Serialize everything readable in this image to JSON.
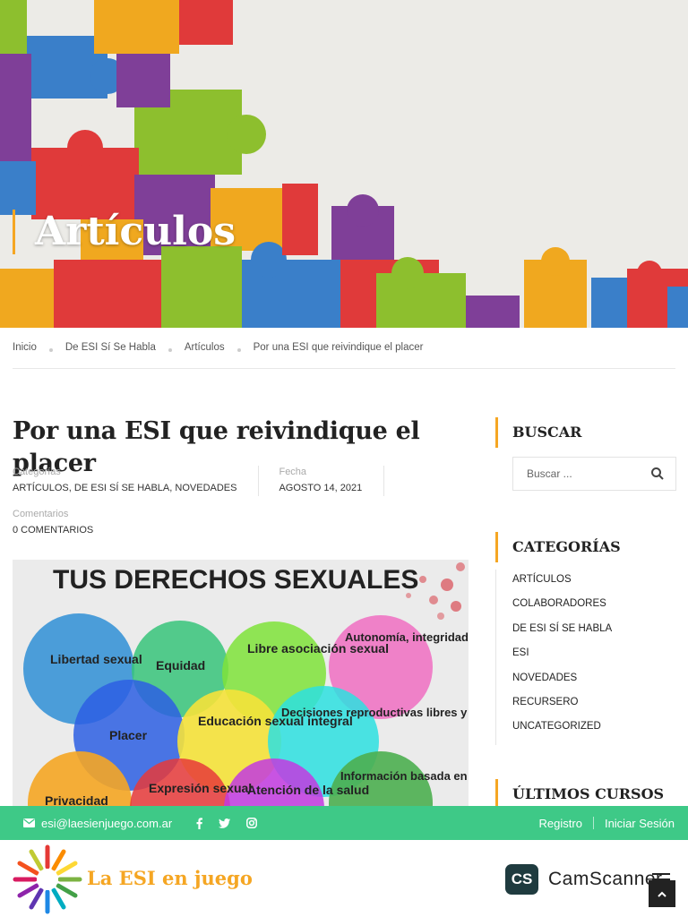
{
  "hero": {
    "title": "Artículos"
  },
  "breadcrumb": [
    "Inicio",
    "De ESI Sí Se Habla",
    "Artículos",
    "Por una ESI que reivindique el placer"
  ],
  "post": {
    "title": "Por una ESI que reivindique el placer",
    "categories_label": "Categorías",
    "categories": [
      "ARTÍCULOS",
      "DE ESI SÍ SE HABLA",
      "NOVEDADES"
    ],
    "date_label": "Fecha",
    "date": "AGOSTO 14, 2021",
    "comments_label": "Comentarios",
    "comments": "0 COMENTARIOS",
    "image": {
      "title": "TUS DERECHOS SEXUALES",
      "bubbles": [
        "Libertad sexual",
        "Equidad",
        "Libre asociación sexual",
        "Autonomía, integridad y seguridad del propio cuerpo",
        "Placer",
        "Educación sexual integral",
        "Decisiones reproductivas libres y responsables",
        "Privacidad",
        "Expresión sexual",
        "Atención de la salud",
        "Información basada en el"
      ]
    }
  },
  "sidebar": {
    "search_title": "BUSCAR",
    "search_placeholder": "Buscar ...",
    "categories_title": "CATEGORÍAS",
    "categories": [
      "ARTÍCULOS",
      "COLABORADORES",
      "DE ESI SÍ SE HABLA",
      "ESI",
      "NOVEDADES",
      "RECURSERO",
      "UNCATEGORIZED"
    ],
    "courses_title": "ÚLTIMOS CURSOS"
  },
  "topbar": {
    "email": "esi@laesienjuego.com.ar",
    "social": [
      "facebook-icon",
      "twitter-icon",
      "instagram-icon"
    ],
    "register": "Registro",
    "login": "Iniciar Sesión"
  },
  "header": {
    "logo_text": "La ESI en juego",
    "watermark_badge": "CS",
    "watermark_text": "CamScanner"
  },
  "colors": {
    "accent": "#f5a623",
    "green": "#3ec987",
    "dark": "#222222"
  }
}
